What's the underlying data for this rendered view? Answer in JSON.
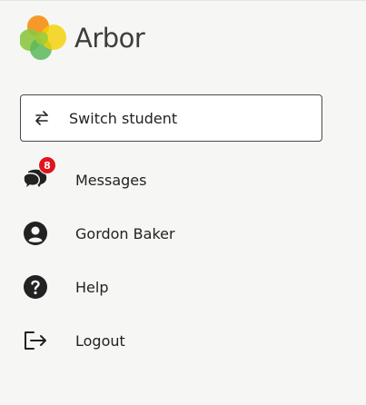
{
  "brand": {
    "name": "Arbor",
    "logo_colors": [
      "#f7941d",
      "#8dc63f",
      "#4caf50",
      "#f5d000"
    ]
  },
  "switch_student": {
    "label": "Switch student",
    "icon": "swap-arrows-icon"
  },
  "nav": {
    "messages": {
      "label": "Messages",
      "icon": "chat-bubbles-icon",
      "badge_count": "8",
      "badge_color": "#e1141e"
    },
    "profile": {
      "label": "Gordon Baker",
      "icon": "user-account-icon"
    },
    "help": {
      "label": "Help",
      "icon": "question-circle-icon"
    },
    "logout": {
      "label": "Logout",
      "icon": "logout-arrow-icon"
    }
  }
}
